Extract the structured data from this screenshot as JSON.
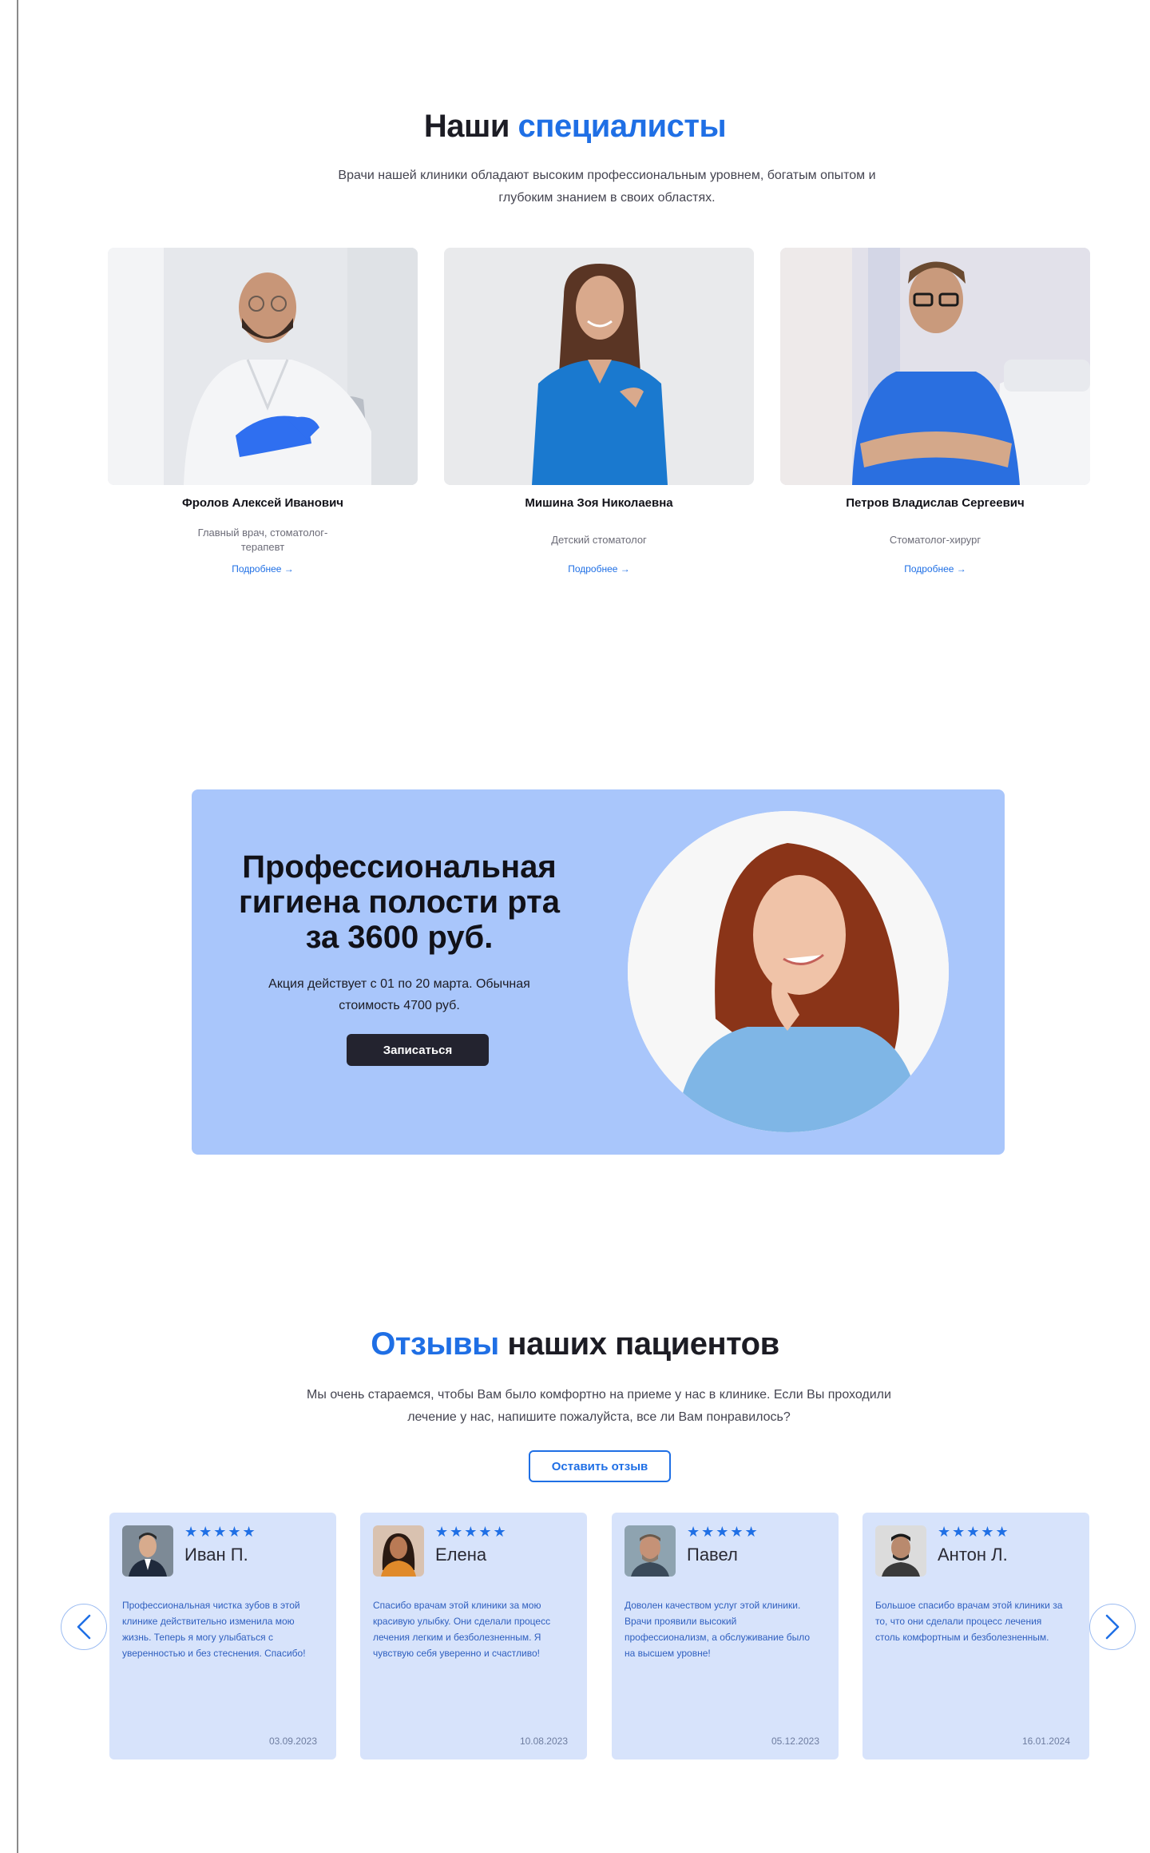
{
  "specialists": {
    "title_main": "Наши",
    "title_accent": "специалисты",
    "subtitle": "Врачи нашей клиники обладают высоким профессиональным уровнем, богатым опытом и глубоким знанием в своих областях.",
    "items": [
      {
        "name": "Фролов Алексей Иванович",
        "role": "Главный врач, стоматолог-терапевт",
        "more": "Подробнее →"
      },
      {
        "name": "Мишина Зоя Николаевна",
        "role": "Детский стоматолог",
        "more": "Подробнее →"
      },
      {
        "name": "Петров Владислав Сергеевич",
        "role": "Стоматолог-хирург",
        "more": "Подробнее →"
      }
    ]
  },
  "promo": {
    "title": "Профессиональная гигиена полости рта за 3600 руб.",
    "text": "Акция действует с 01 по 20 марта. Обычная стоимость 4700 руб.",
    "button": "Записаться"
  },
  "reviews": {
    "title_accent": "Отзывы",
    "title_main": "наших пациентов",
    "subtitle": "Мы очень стараемся, чтобы Вам было комфортно на приеме у нас в клинике. Если Вы проходили лечение у нас, напишите пожалуйста, все ли Вам понравилось?",
    "button": "Оставить отзыв",
    "stars": "★★★★★",
    "items": [
      {
        "name": "Иван П.",
        "text": "Профессиональная чистка зубов в этой клинике действительно изменила мою жизнь. Теперь я могу улыбаться с уверенностью и без стеснения. Спасибо!",
        "date": "03.09.2023"
      },
      {
        "name": "Елена",
        "text": "Спасибо врачам этой клиники за мою красивую улыбку. Они сделали процесс лечения легким и безболезненным. Я чувствую себя уверенно и счастливо!",
        "date": "10.08.2023"
      },
      {
        "name": "Павел",
        "text": "Доволен качеством услуг этой клиники. Врачи проявили высокий профессионализм, а обслуживание было на высшем уровне!",
        "date": "05.12.2023"
      },
      {
        "name": "Антон Л.",
        "text": "Большое спасибо врачам этой клиники за то, что они сделали процесс лечения столь комфортным и безболезненным.",
        "date": "16.01.2024"
      }
    ]
  },
  "colors": {
    "accent": "#1f6fe5",
    "promo_bg": "#a9c6fb",
    "review_card_bg": "#d7e3fb",
    "dark_button": "#23232f"
  }
}
